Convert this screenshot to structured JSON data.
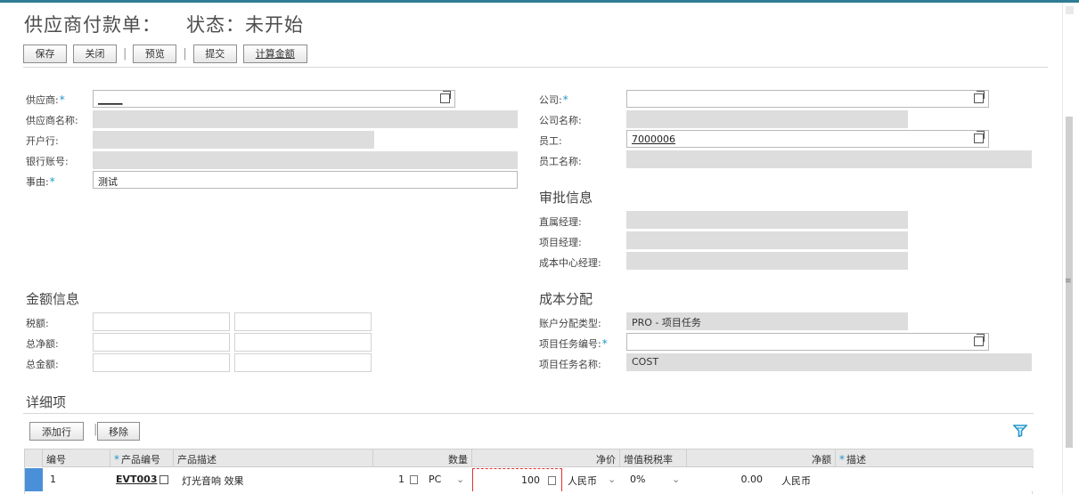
{
  "page": {
    "title": "供应商付款单：",
    "status": "状态：未开始"
  },
  "toolbar": {
    "save": "保存",
    "close": "关闭",
    "preview": "预览",
    "submit": "提交",
    "calc": "计算金额"
  },
  "vendor": {
    "vendor_label": "供应商:",
    "vendor_value": "_____",
    "vendor_name_label": "供应商名称:",
    "bank_label": "开户行:",
    "account_label": "银行账号:",
    "reason_label": "事由:",
    "reason_value": "测试"
  },
  "company": {
    "company_label": "公司:",
    "company_value": "",
    "company_name_label": "公司名称:",
    "company_name_value": "",
    "employee_label": "员工:",
    "employee_value": "7000006",
    "employee_name_label": "员工名称:"
  },
  "approval": {
    "heading": "审批信息",
    "direct_manager_label": "直属经理:",
    "project_manager_label": "项目经理:",
    "cost_center_manager_label": "成本中心经理:"
  },
  "amount": {
    "heading": "金额信息",
    "tax_label": "税额:",
    "net_label": "总净额:",
    "total_label": "总金额:"
  },
  "cost": {
    "heading": "成本分配",
    "assign_type_label": "账户分配类型:",
    "assign_type_value": "PRO - 项目任务",
    "task_no_label": "项目任务编号:",
    "task_name_label": "项目任务名称:",
    "task_name_value": "COST"
  },
  "details": {
    "heading": "详细项",
    "add_row": "添加行",
    "remove": "移除",
    "columns": {
      "no": "编号",
      "product_no": "产品编号",
      "product_desc": "产品描述",
      "qty": "数量",
      "net_price": "净价",
      "vat": "增值税税率",
      "net_amount": "净额",
      "desc": "描述"
    },
    "rows": [
      {
        "no": "1",
        "product_no": "EVT003",
        "product_desc": "灯光音响 效果",
        "qty": "1",
        "unit": "PC",
        "price": "100",
        "currency": "人民币",
        "vat": "0%",
        "net": "0.00",
        "net_currency": "人民币"
      }
    ]
  },
  "colors": {
    "accent": "#2196c9",
    "readonly_bg": "#dddddd",
    "selected_row": "#4a90d9"
  }
}
